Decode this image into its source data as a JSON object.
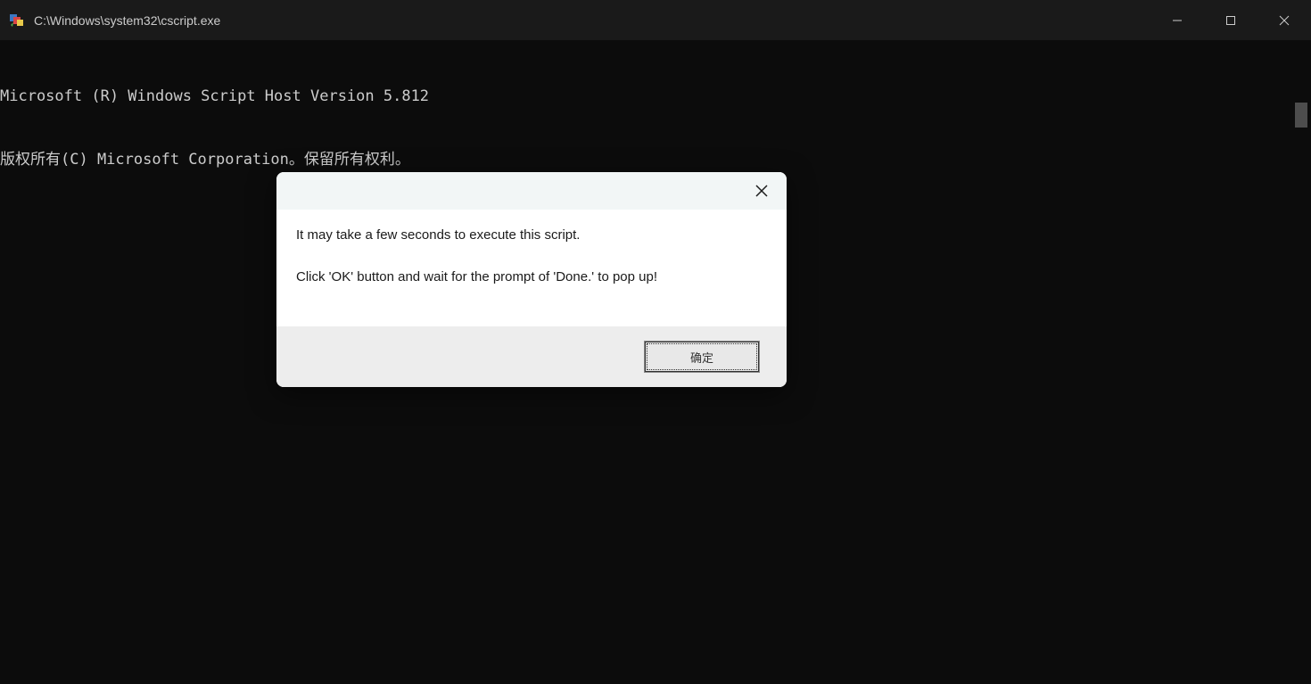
{
  "window": {
    "title": "C:\\Windows\\system32\\cscript.exe"
  },
  "console": {
    "line1": "Microsoft (R) Windows Script Host Version 5.812",
    "line2": "版权所有(C) Microsoft Corporation。保留所有权利。"
  },
  "dialog": {
    "message_line1": "It may take a few seconds to execute this script.",
    "message_line2": "Click 'OK' button and wait for the prompt of 'Done.' to pop up!",
    "ok_label": "确定"
  }
}
